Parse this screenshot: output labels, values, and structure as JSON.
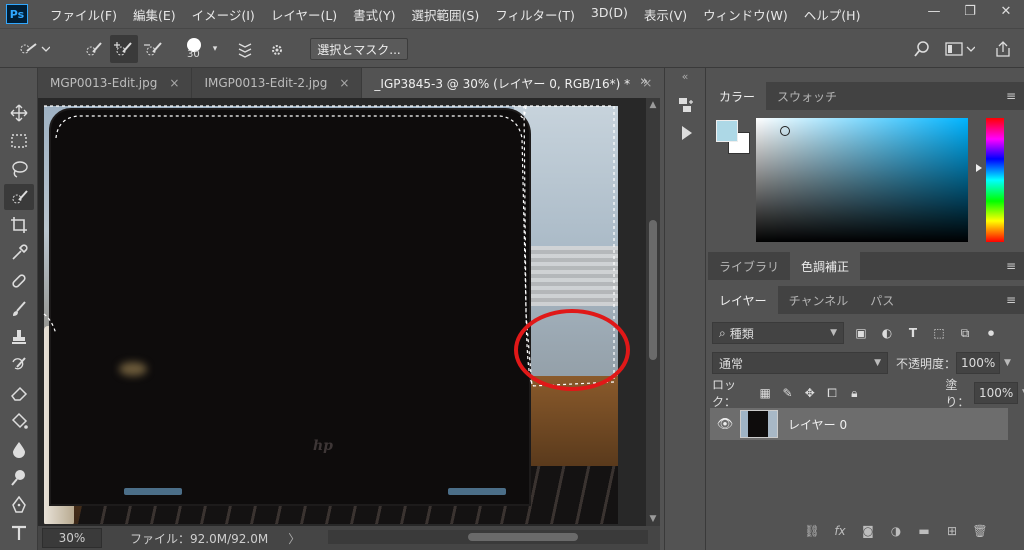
{
  "app": {
    "logo": "Ps"
  },
  "menu": [
    "ファイル(F)",
    "編集(E)",
    "イメージ(I)",
    "レイヤー(L)",
    "書式(Y)",
    "選択範囲(S)",
    "フィルター(T)",
    "3D(D)",
    "表示(V)",
    "ウィンドウ(W)",
    "ヘルプ(H)"
  ],
  "window_controls": {
    "minimize": "—",
    "restore": "❐",
    "close": "✕"
  },
  "options": {
    "brush_size": "30",
    "select_mask": "選択とマスク..."
  },
  "tabs": [
    {
      "label": "MGP0013-Edit.jpg",
      "close": "×"
    },
    {
      "label": "IMGP0013-Edit-2.jpg",
      "close": "×"
    },
    {
      "label": "_IGP3845-3 @ 30% (レイヤー 0, RGB/16*) *",
      "close": "×"
    }
  ],
  "tabs_overflow": "»",
  "status": {
    "zoom": "30%",
    "file": "ファイル：92.0M/92.0M",
    "arrow": "〉"
  },
  "color_panel": {
    "tabs": [
      "カラー",
      "スウォッチ"
    ],
    "foreground": "#add8e6",
    "background": "#ffffff"
  },
  "adjust_panel": {
    "tabs": [
      "ライブラリ",
      "色調補正"
    ]
  },
  "layers_panel": {
    "tabs": [
      "レイヤー",
      "チャンネル",
      "パス"
    ],
    "filter_kind": "種類",
    "blend_mode": "通常",
    "opacity_label": "不透明度：",
    "opacity_value": "100%",
    "lock_label": "ロック：",
    "fill_label": "塗り：",
    "fill_value": "100%",
    "layers": [
      {
        "name": "レイヤー 0",
        "visible": true
      }
    ],
    "footer_icons": [
      "link-icon",
      "fx-icon",
      "mask-icon",
      "adjustment-icon",
      "group-icon",
      "new-layer-icon",
      "trash-icon"
    ],
    "fx": "fx"
  },
  "annotation": {
    "color": "#e01818"
  }
}
